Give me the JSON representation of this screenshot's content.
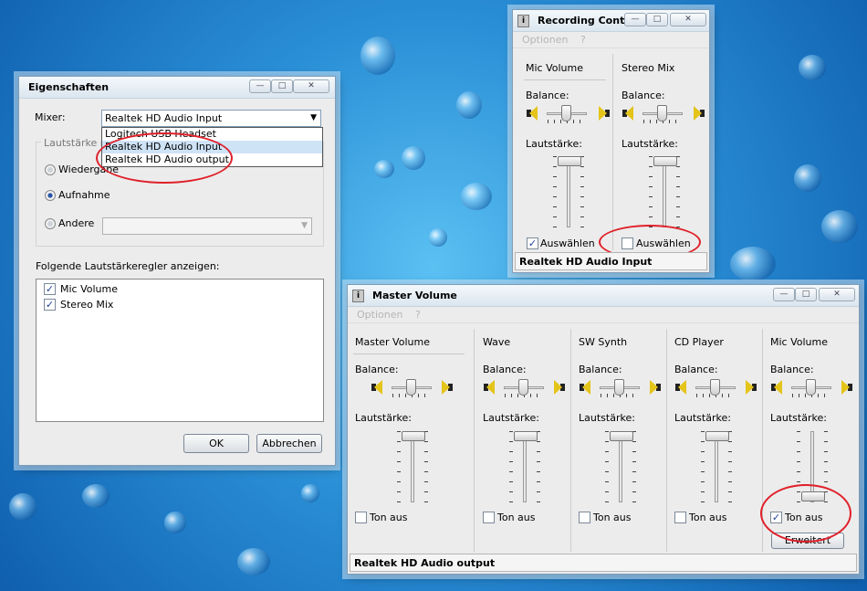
{
  "eigenschaften": {
    "title": "Eigenschaften",
    "mixer_label": "Mixer:",
    "mixer_selected": "Realtek HD Audio Input",
    "mixer_options": [
      "Logitech USB Headset",
      "Realtek HD Audio Input",
      "Realtek HD Audio output"
    ],
    "group_label": "Lautstärke re",
    "radio_playback": "Wiedergabe",
    "radio_record": "Aufnahme",
    "radio_other": "Andere",
    "list_label": "Folgende Lautstärkeregler anzeigen:",
    "list_items": [
      "Mic Volume",
      "Stereo Mix"
    ],
    "ok": "OK",
    "cancel": "Abbrechen"
  },
  "recording": {
    "title": "Recording Cont...",
    "menu": [
      "Optionen",
      "?"
    ],
    "channels": [
      {
        "name": "Mic Volume",
        "balance_label": "Balance:",
        "volume_label": "Lautstärke:",
        "select_label": "Auswählen",
        "selected": true
      },
      {
        "name": "Stereo Mix",
        "balance_label": "Balance:",
        "volume_label": "Lautstärke:",
        "select_label": "Auswählen",
        "selected": false
      }
    ],
    "status": "Realtek HD Audio Input"
  },
  "master": {
    "title": "Master Volume",
    "menu": [
      "Optionen",
      "?"
    ],
    "channels": [
      {
        "name": "Master Volume",
        "balance_label": "Balance:",
        "volume_label": "Lautstärke:",
        "mute_label": "Ton aus",
        "muted": false
      },
      {
        "name": "Wave",
        "balance_label": "Balance:",
        "volume_label": "Lautstärke:",
        "mute_label": "Ton aus",
        "muted": false
      },
      {
        "name": "SW Synth",
        "balance_label": "Balance:",
        "volume_label": "Lautstärke:",
        "mute_label": "Ton aus",
        "muted": false
      },
      {
        "name": "CD Player",
        "balance_label": "Balance:",
        "volume_label": "Lautstärke:",
        "mute_label": "Ton aus",
        "muted": false
      },
      {
        "name": "Mic Volume",
        "balance_label": "Balance:",
        "volume_label": "Lautstärke:",
        "mute_label": "Ton aus",
        "muted": true
      }
    ],
    "advanced": "Erweitert",
    "status": "Realtek HD Audio output"
  },
  "icons": {
    "check": "✓",
    "minimize": "—",
    "maximize": "□",
    "close": "✕",
    "dropdown": "▼",
    "app": "i"
  }
}
